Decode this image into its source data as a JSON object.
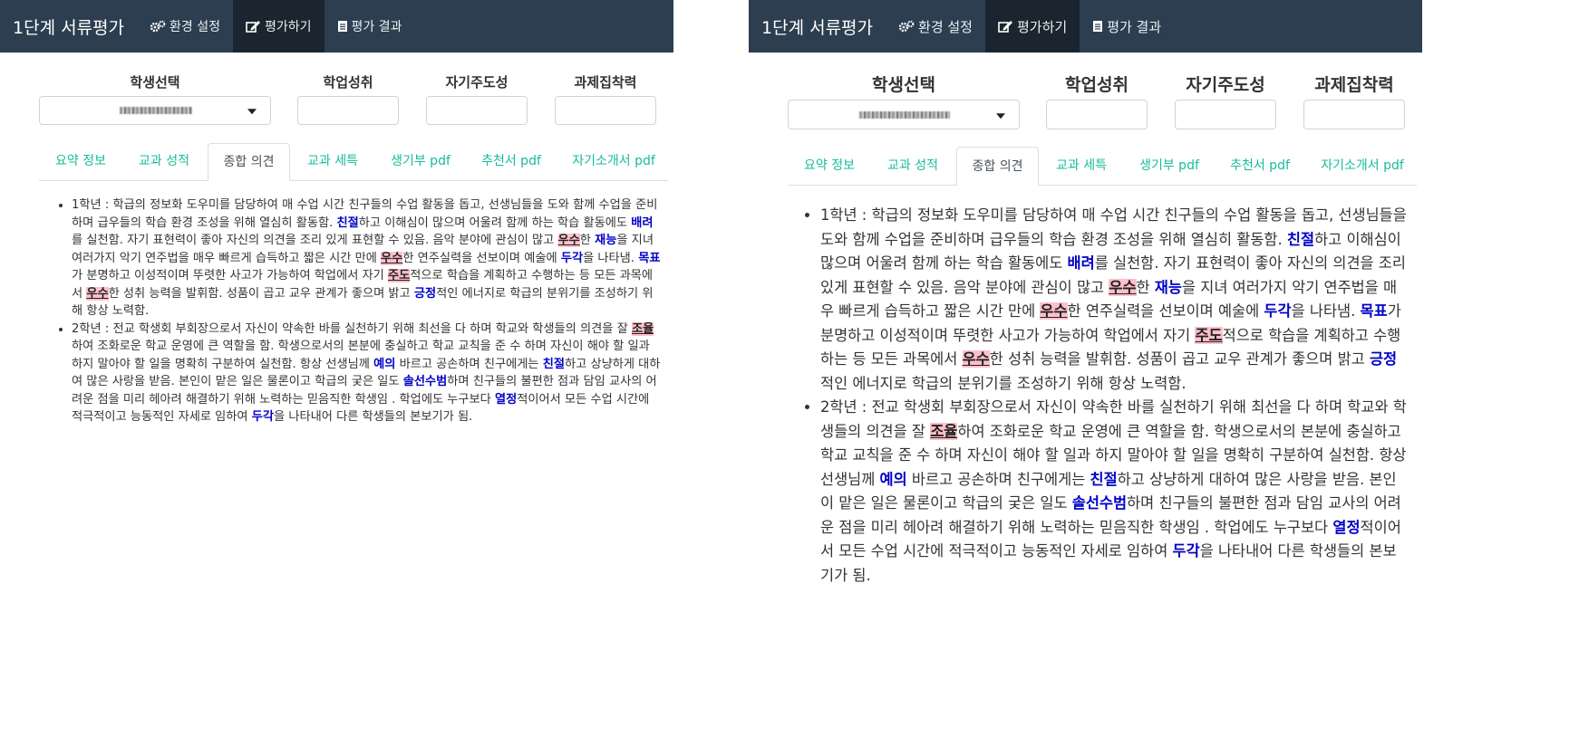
{
  "app": {
    "brand": "1단계 서류평가",
    "nav": [
      {
        "label": "환경 설정",
        "icon": "gears-icon"
      },
      {
        "label": "평가하기",
        "icon": "edit-icon"
      },
      {
        "label": "평가 결과",
        "icon": "document-icon"
      }
    ],
    "active_nav": 1
  },
  "controls": {
    "student_label": "학생선택",
    "score_labels": [
      "학업성취",
      "자기주도성",
      "과제집착력"
    ]
  },
  "tabs": [
    "요약 정보",
    "교과 성적",
    "종합 의견",
    "교과 세특",
    "생기부 pdf",
    "추천서 pdf",
    "자기소개서 pdf"
  ],
  "active_tab": 2,
  "comments": [
    [
      {
        "t": "1학년 : 학급의 정보화 도우미를 담당하여 매 수업 시간 친구들의 수업 활동을 돕고, 선생님들을 도와 함께 수업을 준비하며 급우들의 학습 환경 조성을 위해 열심히 활동함. "
      },
      {
        "t": "친절",
        "s": "kw"
      },
      {
        "t": "하고 이해심이 많으며 어울려 함께 하는 학습 활동에도 "
      },
      {
        "t": "배려",
        "s": "kw"
      },
      {
        "t": "를 실천함. 자기 표현력이 좋아 자신의 의견을 조리 있게 표현할 수 있음. 음악 분야에 관심이 많고 "
      },
      {
        "t": "우수",
        "s": "hl"
      },
      {
        "t": "한 "
      },
      {
        "t": "재능",
        "s": "kw"
      },
      {
        "t": "을 지녀 여러가지 악기 연주법을 매우 빠르게 습득하고 짧은 시간 만에 "
      },
      {
        "t": "우수",
        "s": "hl"
      },
      {
        "t": "한 연주실력을 선보이며 예술에 "
      },
      {
        "t": "두각",
        "s": "kw"
      },
      {
        "t": "을 나타냄. "
      },
      {
        "t": "목표",
        "s": "kw"
      },
      {
        "t": "가 분명하고 이성적이며 뚜렷한 사고가 가능하여 학업에서 자기 "
      },
      {
        "t": "주도",
        "s": "hl"
      },
      {
        "t": "적으로 학습을 계획하고 수행하는 등 모든 과목에서 "
      },
      {
        "t": "우수",
        "s": "hl"
      },
      {
        "t": "한 성취 능력을 발휘함. 성품이 곱고 교우 관계가 좋으며 밝고 "
      },
      {
        "t": "긍정",
        "s": "kw"
      },
      {
        "t": "적인 에너지로 학급의 분위기를 조성하기 위해 항상 노력함."
      }
    ],
    [
      {
        "t": "2학년 : 전교 학생회 부회장으로서 자신이 약속한 바를 실천하기 위해 최선을 다 하며 학교와 학생들의 의견을 잘 "
      },
      {
        "t": "조율",
        "s": "hl"
      },
      {
        "t": "하여 조화로운 학교 운영에 큰 역할을 함. 학생으로서의 본분에 충실하고 학교 교칙을 준 수 하며 자신이 해야 할 일과 하지 말아야 할 일을 명확히 구분하여 실천함. 항상 선생님께 "
      },
      {
        "t": "예의",
        "s": "kw"
      },
      {
        "t": " 바르고 공손하며 친구에게는 "
      },
      {
        "t": "친절",
        "s": "kw"
      },
      {
        "t": "하고 상냥하게 대하여 많은 사랑을 받음. 본인이 맡은 일은 물론이고 학급의 궂은 일도 "
      },
      {
        "t": "솔선수범",
        "s": "kw"
      },
      {
        "t": "하며 친구들의 불편한 점과 담임 교사의 어려운 점을 미리 헤아려 해결하기 위해 노력하는 믿음직한 학생임 . 학업에도 누구보다 "
      },
      {
        "t": "열정",
        "s": "kw"
      },
      {
        "t": "적이어서 모든 수업 시간에 적극적이고 능동적인 자세로 임하여 "
      },
      {
        "t": "두각",
        "s": "kw"
      },
      {
        "t": "을 나타내어 다른 학생들의 본보기가 됨."
      }
    ]
  ],
  "colors": {
    "navbar": "#2c3e50",
    "nav_active": "#1a252f",
    "tab_link": "#18bc9c",
    "keyword": "#0000c8",
    "highlight": "#ffc0cb"
  }
}
